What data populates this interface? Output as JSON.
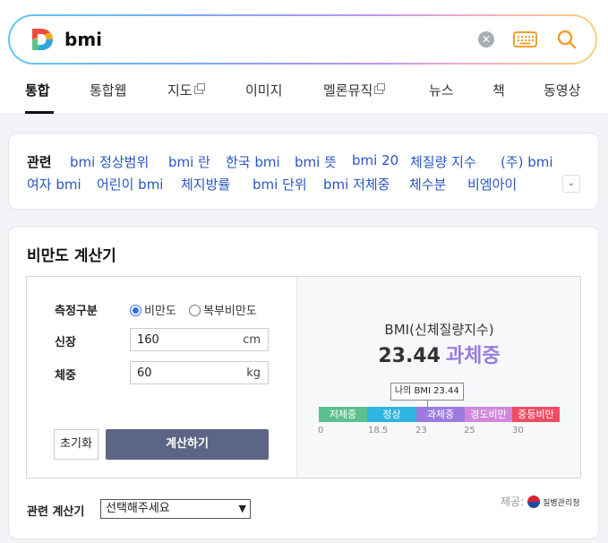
{
  "search": {
    "query": "bmi",
    "clear_glyph": "✕"
  },
  "tabs": [
    {
      "label": "통합",
      "active": true
    },
    {
      "label": "통합웹"
    },
    {
      "label": "지도",
      "external": true
    },
    {
      "label": "이미지"
    },
    {
      "label": "멜론뮤직",
      "external": true
    },
    {
      "label": "뉴스"
    },
    {
      "label": "책"
    },
    {
      "label": "동영상"
    }
  ],
  "related": {
    "label": "관련",
    "links": [
      "bmi 정상범위",
      "bmi 란",
      "한국 bmi",
      "bmi 뜻",
      "bmi 20",
      "체질량 지수",
      "(주) bmi",
      "여자 bmi",
      "어린이 bmi",
      "체지방률",
      "bmi 단위",
      "bmi 저체중",
      "체수분",
      "비엠아이"
    ],
    "more_glyph": "⌄"
  },
  "calculator": {
    "title": "비만도 계산기",
    "measure_label": "측정구분",
    "options": [
      {
        "label": "비만도",
        "checked": true
      },
      {
        "label": "복부비만도",
        "checked": false
      }
    ],
    "height": {
      "label": "신장",
      "value": "160",
      "unit": "cm"
    },
    "weight": {
      "label": "체중",
      "value": "60",
      "unit": "kg"
    },
    "reset_label": "초기화",
    "calc_label": "계산하기",
    "result": {
      "label": "BMI(신체질량지수)",
      "value": "23.44",
      "status": "과체중",
      "marker": "나의 BMI 23.44",
      "bmi": 23.44
    },
    "scale": {
      "segments": [
        {
          "label": "저체중",
          "color": "#5cc08e"
        },
        {
          "label": "정상",
          "color": "#2fb3e0"
        },
        {
          "label": "과체중",
          "color": "#9b7be0"
        },
        {
          "label": "경도비만",
          "color": "#d088dd"
        },
        {
          "label": "중등비만",
          "color": "#ef4d62"
        }
      ],
      "ticks": [
        "0",
        "18.5",
        "23",
        "25",
        "30"
      ]
    }
  },
  "footer": {
    "related_label": "관련 계산기",
    "select_value": "선택해주세요",
    "provider_label": "제공:",
    "provider_name": "질병관리청"
  }
}
